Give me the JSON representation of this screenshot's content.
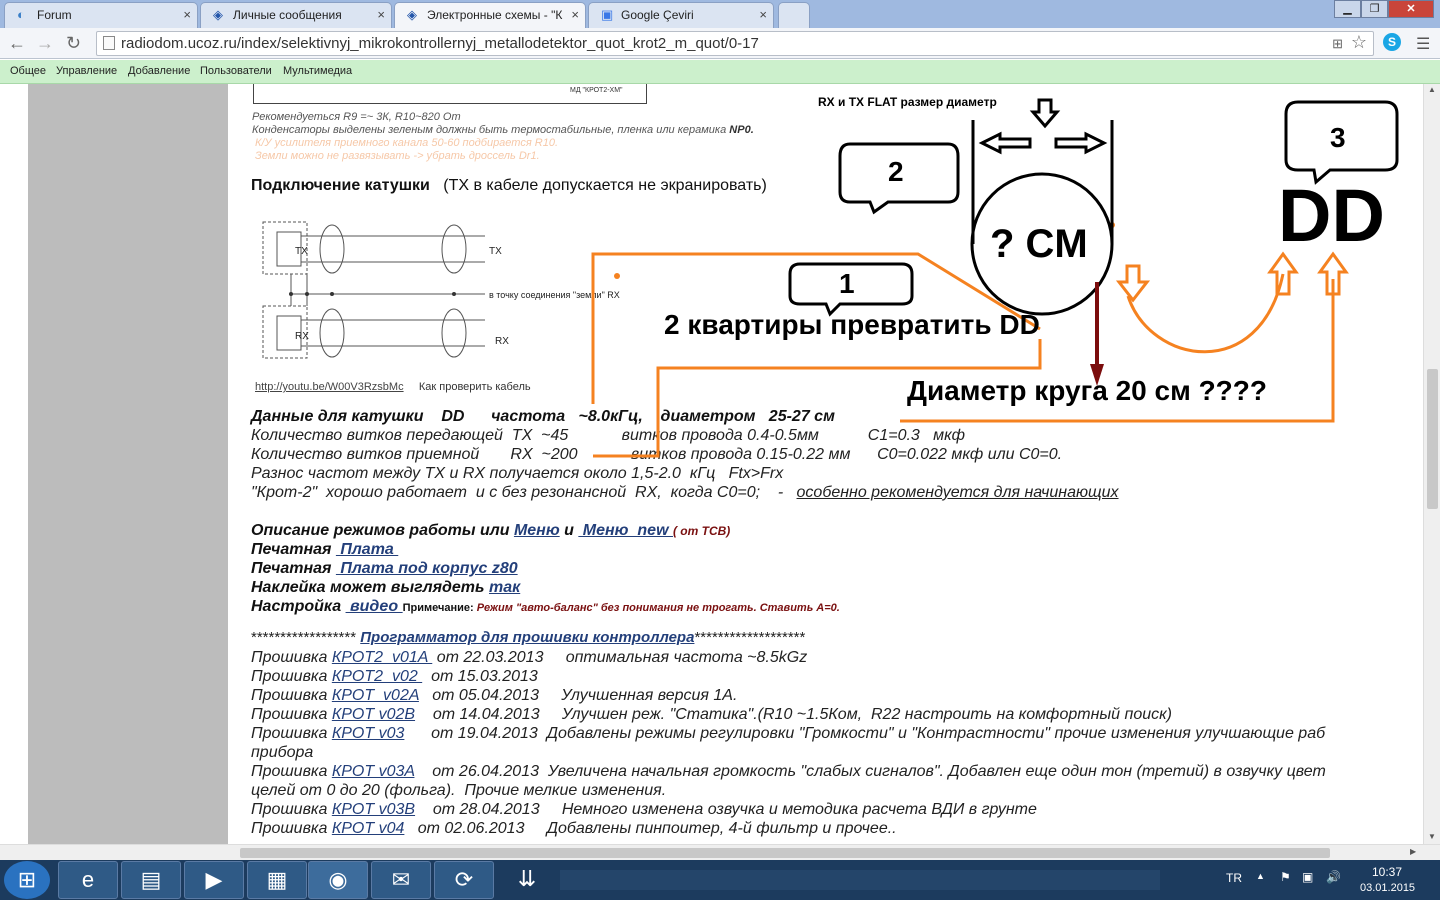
{
  "tabs": [
    {
      "label": "Forum",
      "icon": "forum-icon"
    },
    {
      "label": "Личные сообщения",
      "icon": "ucoz-icon"
    },
    {
      "label": "Электронные схемы - \"К",
      "icon": "ucoz-icon"
    },
    {
      "label": "Google Çeviri",
      "icon": "translate-icon"
    }
  ],
  "address": "radiodom.ucoz.ru/index/selektivnyj_mikrokontrollernyj_metallodetektor_quot_krot2_m_quot/0-17",
  "bookmarks": [
    "Общее",
    "Управление",
    "Добавление",
    "Пользователи",
    "Мультимедиа"
  ],
  "content": {
    "schem_caption": "МД \"КРОТ2-ХМ\"",
    "note1": "Рекомендуеться R9 =~ 3К,  R10~820 Om",
    "note2a": "Конденсаторы  выделены зеленым должны быть термостабильные,  пленка или керамика ",
    "note2b": "NP0.",
    "note3": "К/У усилителя приемного канала   50-60  подбирается R10.",
    "note4": "Земли можно не развязывать -> убрать дроссель Dr1.",
    "coil_heading": "Подключение катушки",
    "coil_heading_note": "(TX в кабеле допускается не экранировать)",
    "diagram": {
      "tx_left": "TX",
      "tx_right": "TX",
      "rx_left": "RX",
      "rx_right": "RX",
      "ground": "в точку соединения \"земли\" RX"
    },
    "video_link": "http://youtu.be/W00V3RzsbMc",
    "video_note": "Как проверить кабель",
    "dd_line": "Данные для катушки    DD      частота   ~8.0кГц,    диаметром   25-27 см",
    "tx_turns": "Количество витков передающей  TX  ~45            витков провода 0.4-0.5мм           C1=0.3   мкф",
    "rx_turns": "Количество витков приемной       RX  ~200            витков провода 0.15-0.22 мм      C0=0.022 мкф или C0=0.",
    "freq_diff": "Разнос частот между TX и RX получается около 1,5-2.0  кГц   Ftx>Frx",
    "krot_line": "\"Крот-2\"  хорошо работает  и с без резонансной  RX,  когда C0=0;    -   ",
    "krot_line_link": "особенно рекомендуется для начинающих",
    "modes_label": "Описание режимов работы или ",
    "modes_link1": "Меню",
    "modes_and": " и ",
    "modes_link2": " Меню  new ",
    "modes_tcb": "( от ТСВ)",
    "pcb_label": "Печатная ",
    "pcb_link": " Плата ",
    "pcb2_label": "Печатная ",
    "pcb2_link": " Плата под корпус z80",
    "sticker_label": "Наклейка может выглядеть ",
    "sticker_link": "так",
    "setup_label": "Настройка ",
    "setup_link": " видео ",
    "setup_note_label": "Примечание: ",
    "setup_note": "Режим \"авто-баланс\" без понимания не трогать. Ставить A=0.",
    "prog_stars_left": "******************",
    "prog_link": "Программатор для прошивки контроллера",
    "prog_stars_right": "*******************",
    "firmware": [
      {
        "pre": "Прошивка ",
        "link": "КРОТ2  v01A ",
        "post": " от 22.03.2013     оптимальная частота ~8.5kGz"
      },
      {
        "pre": "Прошивка ",
        "link": "КРОТ2  v02 ",
        "post": "  от 15.03.2013"
      },
      {
        "pre": "Прошивка ",
        "link": "КРОТ  v02A",
        "post": "   от 05.04.2013     Улучшенная версия 1А."
      },
      {
        "pre": "Прошивка ",
        "link": "КРОТ v02B",
        "post": "    от 14.04.2013     Улучшен реж. \"Статика\".(R10 ~1.5Ком,  R22 настроить на комфортный поиск)"
      },
      {
        "pre": "Прошивка ",
        "link": "КРОТ v03",
        "post": "      от 19.04.2013  Добавлены режимы регулировки \"Громкости\" и \"Контрастности\" прочие изменения улучшающие раб"
      },
      {
        "pre": "прибора",
        "link": "",
        "post": ""
      },
      {
        "pre": "Прошивка ",
        "link": "КРОТ v03A",
        "post": "    от 26.04.2013  Увеличена начальная громкость \"слабых сигналов\". Добавлен еще один тон (третий) в озвучку цвет"
      },
      {
        "pre": "целей от 0 до 20 (фольга).  Прочие мелкие изменения.",
        "link": "",
        "post": ""
      },
      {
        "pre": "Прошивка ",
        "link": "КРОТ v03B",
        "post": "    от 28.04.2013     Немного изменена озвучка и методика расчета ВДИ в грунте"
      },
      {
        "pre": "Прошивка ",
        "link": "КРОТ v04",
        "post": "   от 02.06.2013     Добавлены пинпоитер, 4-й фильтр и прочее.."
      }
    ]
  },
  "annotations": {
    "flat_label": "RX и TX FLAT размер диаметр",
    "bubble1": "1",
    "bubble2": "2",
    "bubble3": "3",
    "circle_text": "? CM",
    "dd_big": "DD",
    "two_to_dd": "2 квартиры превратить DD",
    "diameter_q": "Диаметр круга 20 см ????"
  },
  "taskbar": {
    "lang": "TR",
    "time": "10:37",
    "date": "03.01.2015"
  },
  "colors": {
    "orange": "#f58220",
    "darkred": "#7b0d0d",
    "link": "#233f7a",
    "bookmarks_bg": "#ccf0cc",
    "taskbar": "#1c3b5e"
  }
}
